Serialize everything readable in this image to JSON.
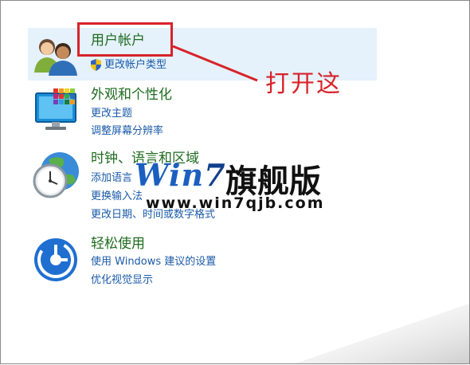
{
  "categories": [
    {
      "title": "用户帐户",
      "links": [
        "更改帐户类型"
      ],
      "icon": "users-icon"
    },
    {
      "title": "外观和个性化",
      "links": [
        "更改主题",
        "调整屏幕分辨率"
      ],
      "icon": "monitor-icon"
    },
    {
      "title": "时钟、语言和区域",
      "links": [
        "添加语言",
        "更换输入法",
        "更改日期、时间或数字格式"
      ],
      "icon": "clock-globe-icon"
    },
    {
      "title": "轻松使用",
      "links": [
        "使用 Windows 建议的设置",
        "优化视觉显示"
      ],
      "icon": "ease-of-access-icon"
    }
  ],
  "annotation": {
    "text": "打开这",
    "color": "#d8232a"
  },
  "watermark": {
    "logo_win": "Win",
    "logo_seven": "7",
    "brand_cn": "旗舰版",
    "url": "www.win7qjb.com"
  }
}
